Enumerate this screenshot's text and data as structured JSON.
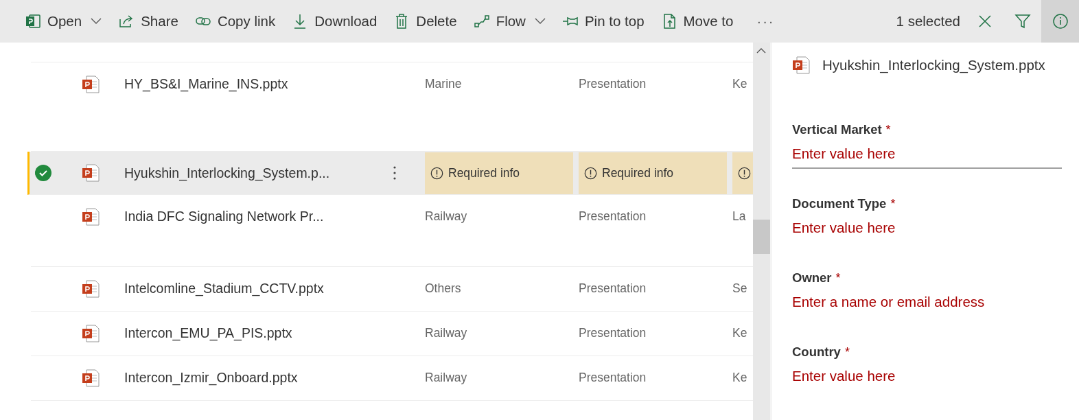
{
  "toolbar": {
    "commands": [
      {
        "label": "Open",
        "caret": true
      },
      {
        "label": "Share",
        "caret": false
      },
      {
        "label": "Copy link",
        "caret": false
      },
      {
        "label": "Download",
        "caret": false
      },
      {
        "label": "Delete",
        "caret": false
      },
      {
        "label": "Flow",
        "caret": true
      },
      {
        "label": "Pin to top",
        "caret": false
      },
      {
        "label": "Move to",
        "caret": false
      }
    ],
    "more": "···",
    "selection_count": "1 selected",
    "info_selected": true
  },
  "files": {
    "rows": [
      {
        "name": "HY_BS&I_Marine_INS.pptx",
        "selected": false,
        "cells": [
          {
            "kind": "text",
            "text": "Marine"
          },
          {
            "kind": "text",
            "text": "Presentation"
          },
          {
            "kind": "text",
            "text": "Ke"
          }
        ]
      },
      {
        "name": "Hyukshin_Interlocking_System.p...",
        "selected": true,
        "cells": [
          {
            "kind": "required",
            "text": "Required info"
          },
          {
            "kind": "required",
            "text": "Required info"
          },
          {
            "kind": "required"
          }
        ]
      },
      {
        "name": "India DFC Signaling Network Pr...",
        "selected": false,
        "cells": [
          {
            "kind": "text",
            "text": "Railway"
          },
          {
            "kind": "text",
            "text": "Presentation"
          },
          {
            "kind": "text",
            "text": "La"
          }
        ]
      },
      {
        "name": "Intelcomline_Stadium_CCTV.pptx",
        "selected": false,
        "cells": [
          {
            "kind": "text",
            "text": "Others"
          },
          {
            "kind": "text",
            "text": "Presentation"
          },
          {
            "kind": "text",
            "text": "Se"
          }
        ]
      },
      {
        "name": "Intercon_EMU_PA_PIS.pptx",
        "selected": false,
        "cells": [
          {
            "kind": "text",
            "text": "Railway"
          },
          {
            "kind": "text",
            "text": "Presentation"
          },
          {
            "kind": "text",
            "text": "Ke"
          }
        ]
      },
      {
        "name": "Intercon_Izmir_Onboard.pptx",
        "selected": false,
        "cells": [
          {
            "kind": "text",
            "text": "Railway"
          },
          {
            "kind": "text",
            "text": "Presentation"
          },
          {
            "kind": "text",
            "text": "Ke"
          }
        ]
      }
    ]
  },
  "details_panel": {
    "file_name": "Hyukshin_Interlocking_System.pptx",
    "fields": [
      {
        "label": "Vertical Market",
        "marker": "*",
        "placeholder": "Enter value here",
        "focused": true
      },
      {
        "label": "Document Type",
        "marker": "*",
        "placeholder": "Enter value here",
        "focused": false
      },
      {
        "label": "Owner",
        "marker": "*",
        "placeholder": "Enter a name or email address",
        "focused": false
      },
      {
        "label": "Country",
        "marker": "*",
        "placeholder": "Enter value here",
        "focused": false
      }
    ]
  }
}
